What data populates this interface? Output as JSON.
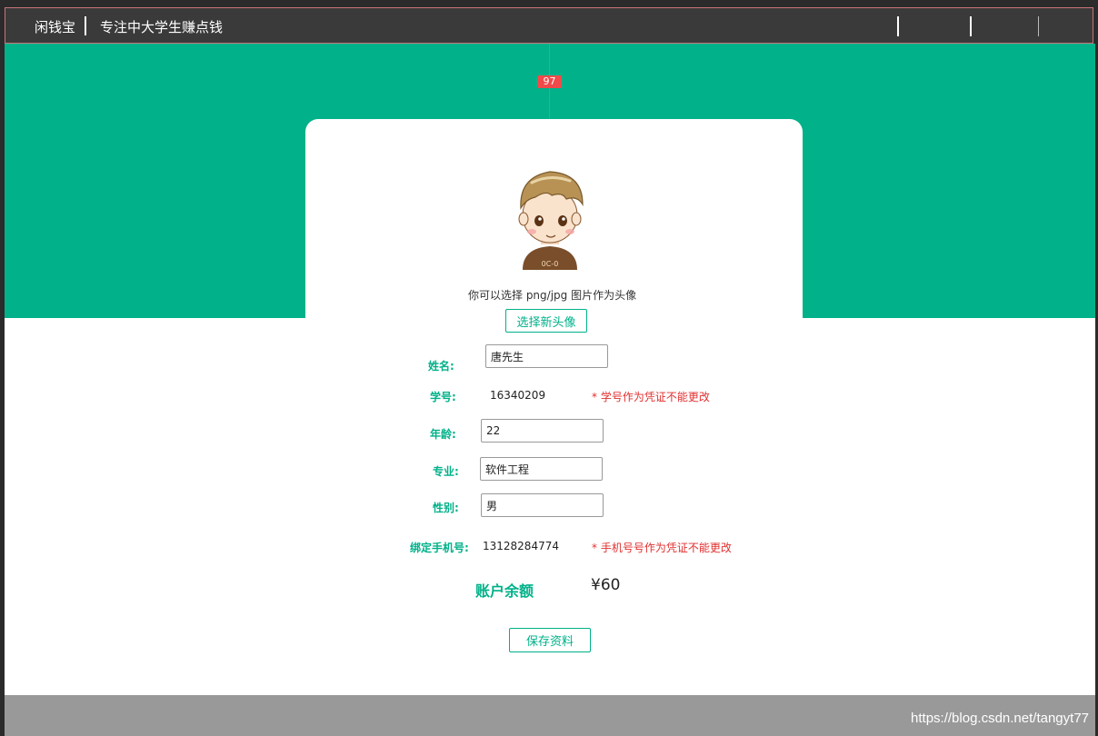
{
  "nav": {
    "brand": "闲钱宝",
    "slogan": "专注中大学生赚点钱"
  },
  "overlay": {
    "measure_badge": "97"
  },
  "profile": {
    "avatar_hint": "你可以选择 png/jpg 图片作为头像",
    "choose_avatar_label": "选择新头像",
    "fields": {
      "name_label": "姓名:",
      "name_value": "唐先生",
      "student_id_label": "学号:",
      "student_id_value": "16340209",
      "student_id_note": "* 学号作为凭证不能更改",
      "age_label": "年龄:",
      "age_value": "22",
      "major_label": "专业:",
      "major_value": "软件工程",
      "gender_label": "性别:",
      "gender_value": "男",
      "phone_label": "绑定手机号:",
      "phone_value": "13128284774",
      "phone_note": "* 手机号号作为凭证不能更改"
    },
    "balance_label": "账户余额",
    "balance_value": "¥60",
    "save_label": "保存资料"
  },
  "footer": {
    "watermark": "https://blog.csdn.net/tangyt77"
  },
  "colors": {
    "accent": "#00b189",
    "warning": "#e03030",
    "nav_bg": "#3a3a3a",
    "footer_bg": "#999999"
  }
}
